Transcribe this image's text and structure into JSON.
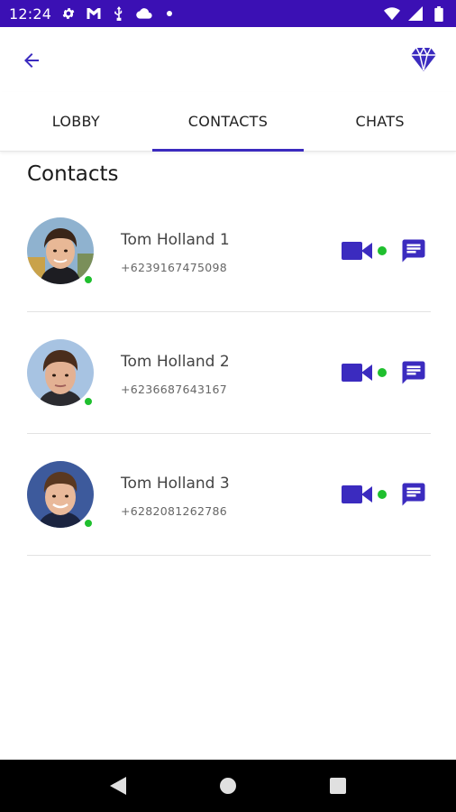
{
  "status_bar": {
    "time": "12:24",
    "icons_left": [
      "settings-icon",
      "gmail-icon",
      "usb-debug-icon",
      "cloud-icon",
      "dot-icon"
    ],
    "icons_right": [
      "wifi-icon",
      "signal-icon",
      "battery-icon"
    ],
    "background": "#3b10b4"
  },
  "app_bar": {
    "back_icon": "arrow-left-icon",
    "premium_icon": "diamond-icon"
  },
  "tabs": [
    {
      "label": "LOBBY",
      "active": false
    },
    {
      "label": "CONTACTS",
      "active": true
    },
    {
      "label": "CHATS",
      "active": false
    }
  ],
  "section_title": "Contacts",
  "contacts": [
    {
      "name": "Tom Holland 1",
      "phone": "+6239167475098",
      "online": true
    },
    {
      "name": "Tom Holland 2",
      "phone": "+6236687643167",
      "online": true
    },
    {
      "name": "Tom Holland 3",
      "phone": "+6282081262786",
      "online": true
    }
  ],
  "colors": {
    "accent": "#3b2bbf",
    "online": "#1fbf2e",
    "status_bar": "#3b10b4"
  },
  "nav_bar": {
    "buttons": [
      "back-triangle-icon",
      "home-circle-icon",
      "recents-square-icon"
    ]
  }
}
